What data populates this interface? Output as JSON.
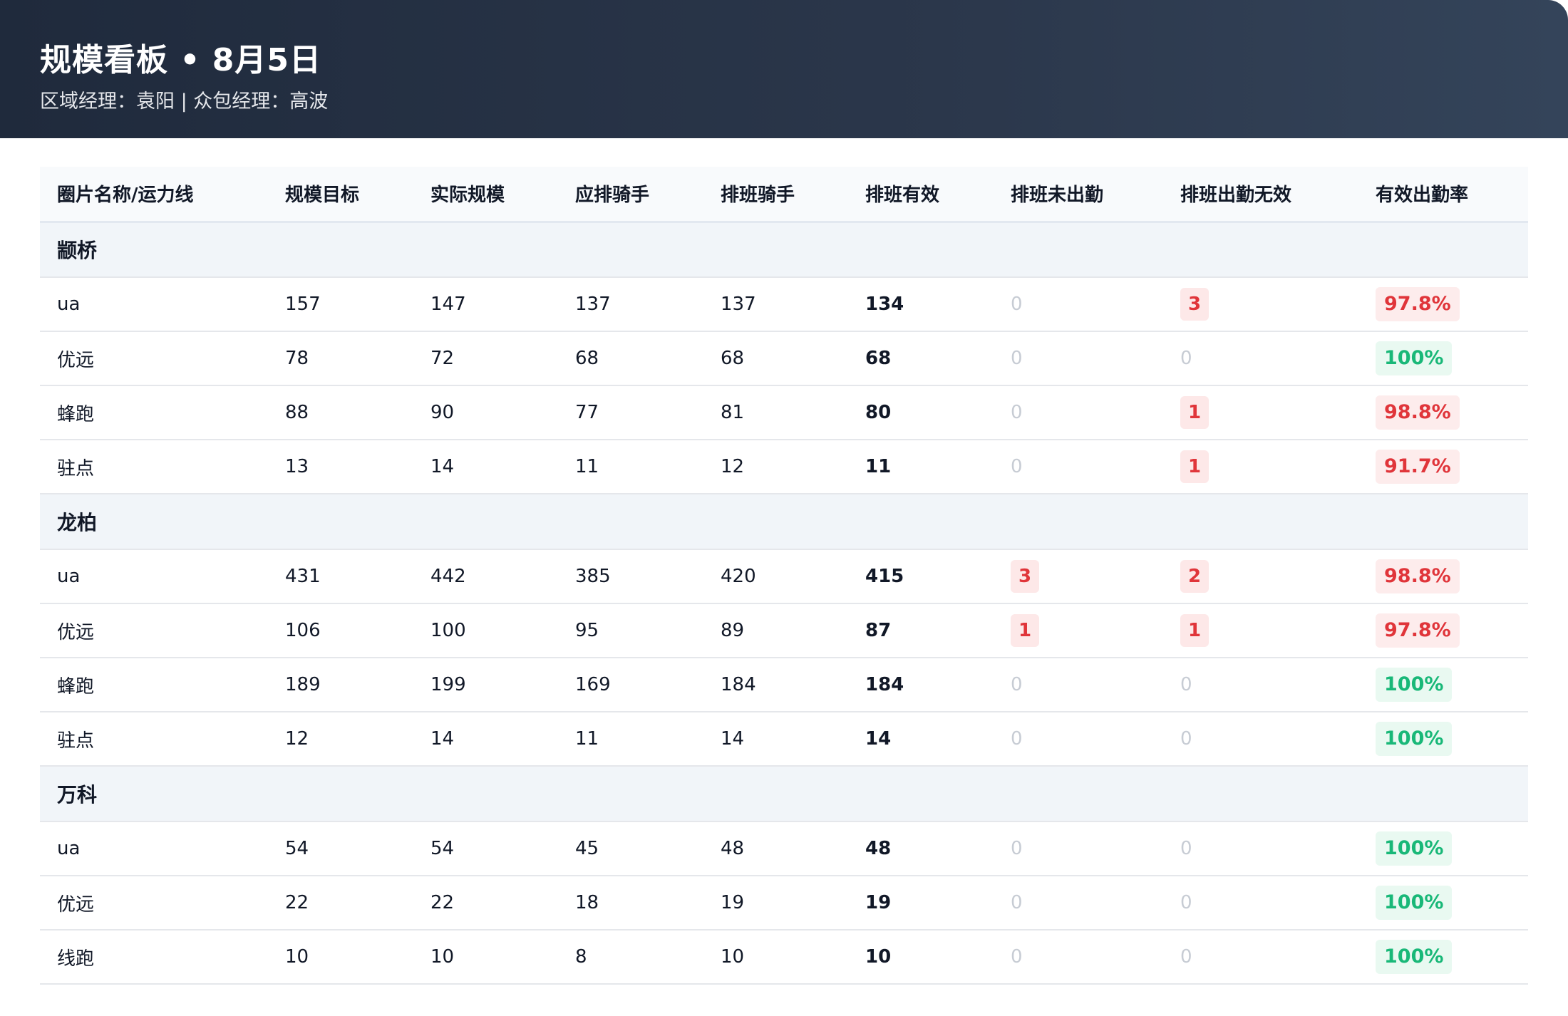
{
  "header": {
    "title": "规模看板 • 8月5日",
    "subtitle": "区域经理：袁阳 | 众包经理：高波"
  },
  "table": {
    "columns": [
      "圈片名称/运力线",
      "规模目标",
      "实际规模",
      "应排骑手",
      "排班骑手",
      "排班有效",
      "排班未出勤",
      "排班出勤无效",
      "有效出勤率"
    ],
    "groups": [
      {
        "name": "颛桥",
        "rows": [
          {
            "line": "ua",
            "target": "157",
            "actual": "147",
            "should": "137",
            "scheduled": "137",
            "valid": "134",
            "absent": "0",
            "invalid": "3",
            "rate": "97.8%",
            "rate_status": "red"
          },
          {
            "line": "优远",
            "target": "78",
            "actual": "72",
            "should": "68",
            "scheduled": "68",
            "valid": "68",
            "absent": "0",
            "invalid": "0",
            "rate": "100%",
            "rate_status": "green"
          },
          {
            "line": "蜂跑",
            "target": "88",
            "actual": "90",
            "should": "77",
            "scheduled": "81",
            "valid": "80",
            "absent": "0",
            "invalid": "1",
            "rate": "98.8%",
            "rate_status": "red"
          },
          {
            "line": "驻点",
            "target": "13",
            "actual": "14",
            "should": "11",
            "scheduled": "12",
            "valid": "11",
            "absent": "0",
            "invalid": "1",
            "rate": "91.7%",
            "rate_status": "red"
          }
        ]
      },
      {
        "name": "龙柏",
        "rows": [
          {
            "line": "ua",
            "target": "431",
            "actual": "442",
            "should": "385",
            "scheduled": "420",
            "valid": "415",
            "absent": "3",
            "invalid": "2",
            "rate": "98.8%",
            "rate_status": "red"
          },
          {
            "line": "优远",
            "target": "106",
            "actual": "100",
            "should": "95",
            "scheduled": "89",
            "valid": "87",
            "absent": "1",
            "invalid": "1",
            "rate": "97.8%",
            "rate_status": "red"
          },
          {
            "line": "蜂跑",
            "target": "189",
            "actual": "199",
            "should": "169",
            "scheduled": "184",
            "valid": "184",
            "absent": "0",
            "invalid": "0",
            "rate": "100%",
            "rate_status": "green"
          },
          {
            "line": "驻点",
            "target": "12",
            "actual": "14",
            "should": "11",
            "scheduled": "14",
            "valid": "14",
            "absent": "0",
            "invalid": "0",
            "rate": "100%",
            "rate_status": "green"
          }
        ]
      },
      {
        "name": "万科",
        "rows": [
          {
            "line": "ua",
            "target": "54",
            "actual": "54",
            "should": "45",
            "scheduled": "48",
            "valid": "48",
            "absent": "0",
            "invalid": "0",
            "rate": "100%",
            "rate_status": "green"
          },
          {
            "line": "优远",
            "target": "22",
            "actual": "22",
            "should": "18",
            "scheduled": "19",
            "valid": "19",
            "absent": "0",
            "invalid": "0",
            "rate": "100%",
            "rate_status": "green"
          },
          {
            "line": "线跑",
            "target": "10",
            "actual": "10",
            "should": "8",
            "scheduled": "10",
            "valid": "10",
            "absent": "0",
            "invalid": "0",
            "rate": "100%",
            "rate_status": "green"
          }
        ]
      }
    ]
  },
  "colors": {
    "header_bg": "#1f2a3c",
    "alert_red": "#e0353a",
    "ok_green": "#19b878"
  }
}
